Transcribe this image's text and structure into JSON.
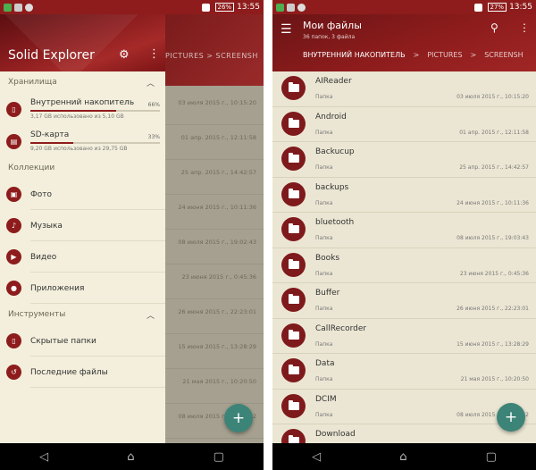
{
  "status_left": {
    "battery": "26%",
    "time": "13:55"
  },
  "status_right": {
    "battery": "27%",
    "time": "13:55"
  },
  "drawer": {
    "title": "Solid Explorer",
    "storage_header": "Хранилища",
    "storages": [
      {
        "name": "Внутренний накопитель",
        "percent": "66%",
        "fraction": 0.66,
        "usage": "3,17 GB использовано из 5,10 GB"
      },
      {
        "name": "SD-карта",
        "percent": "33%",
        "fraction": 0.33,
        "usage": "9,20 GB использовано из 29,75 GB"
      }
    ],
    "collections_header": "Коллекции",
    "collections": [
      {
        "label": "Фото",
        "icon": "photo-icon"
      },
      {
        "label": "Музыка",
        "icon": "music-icon"
      },
      {
        "label": "Видео",
        "icon": "video-icon"
      },
      {
        "label": "Приложения",
        "icon": "android-icon"
      }
    ],
    "tools_header": "Инструменты",
    "tools": [
      {
        "label": "Скрытые папки",
        "icon": "hidden-folder-icon"
      },
      {
        "label": "Последние файлы",
        "icon": "history-icon"
      }
    ]
  },
  "behind": {
    "crumb": "PICTURES  >  SCREENSH",
    "dates": [
      "03 июля 2015 г., 10:15:20",
      "01 апр. 2015 г., 12:11:58",
      "25 апр. 2015 г., 14:42:57",
      "24 июня 2015 г., 10:11:36",
      "08 июля 2015 г., 19:02:43",
      "23 июня 2015 г., 0:45:36",
      "26 июня 2015 г., 22:23:01",
      "15 июня 2015 г., 13:28:29",
      "21 мая 2015 г., 10:20:50",
      "08 июля 2015 г., 13:47:32"
    ]
  },
  "appbar": {
    "title": "Мои файлы",
    "subtitle": "36 папок, 3 файла",
    "crumb_current": "ВНУТРЕННИЙ НАКОПИТЕЛЬ",
    "crumb_next": "PICTURES",
    "crumb_next2": "SCREENSH"
  },
  "files": [
    {
      "name": "AIReader",
      "type": "Папка",
      "date": "03 июля 2015 г., 10:15:20"
    },
    {
      "name": "Android",
      "type": "Папка",
      "date": "01 апр. 2015 г., 12:11:58"
    },
    {
      "name": "Backucup",
      "type": "Папка",
      "date": "25 апр. 2015 г., 14:42:57"
    },
    {
      "name": "backups",
      "type": "Папка",
      "date": "24 июня 2015 г., 10:11:36"
    },
    {
      "name": "bluetooth",
      "type": "Папка",
      "date": "08 июля 2015 г., 19:03:43"
    },
    {
      "name": "Books",
      "type": "Папка",
      "date": "23 июня 2015 г., 0:45:36"
    },
    {
      "name": "Buffer",
      "type": "Папка",
      "date": "26 июня 2015 г., 22:23:01"
    },
    {
      "name": "CallRecorder",
      "type": "Папка",
      "date": "15 июня 2015 г., 13:28:29"
    },
    {
      "name": "Data",
      "type": "Папка",
      "date": "21 мая 2015 г., 10:20:50"
    },
    {
      "name": "DCIM",
      "type": "Папка",
      "date": "08 июля 2015 г., 13:47:32"
    },
    {
      "name": "Download",
      "type": "",
      "date": ""
    }
  ],
  "fab_label": "+"
}
